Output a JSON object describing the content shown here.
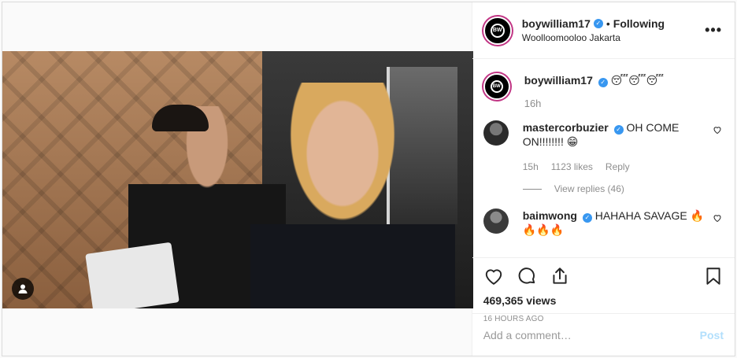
{
  "post": {
    "author": "boywilliam17",
    "follow_status": "Following",
    "location": "Woolloomooloo Jakarta",
    "more_label": "•••",
    "caption_emoji": "😴😴😴",
    "caption_time": "16h",
    "logo_text": "BW"
  },
  "comments": [
    {
      "username": "mastercorbuzier",
      "text": "OH COME ON!!!!!!!! 😁",
      "time": "15h",
      "likes": "1123 likes",
      "reply_label": "Reply",
      "view_replies": "View replies (46)"
    },
    {
      "username": "baimwong",
      "text": "HAHAHA SAVAGE 🔥🔥🔥🔥"
    }
  ],
  "stats": {
    "views": "469,365 views",
    "posted_ago": "16 HOURS AGO"
  },
  "composer": {
    "placeholder": "Add a comment…",
    "post_label": "Post"
  },
  "colors": {
    "verified": "#3897f0",
    "story_ring": "#c13584",
    "post_disabled": "#b2dffc"
  },
  "icons": [
    "heart-icon",
    "comment-icon",
    "share-icon",
    "bookmark-icon",
    "user-tag-icon",
    "verified-icon",
    "more-icon"
  ]
}
